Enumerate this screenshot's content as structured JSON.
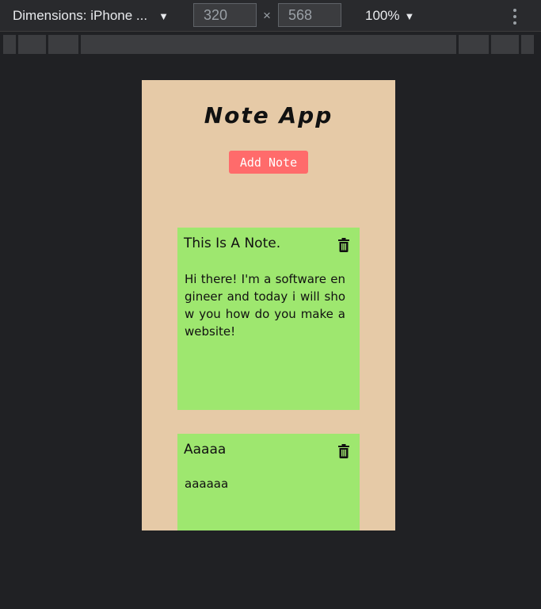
{
  "devtools": {
    "device_label": "Dimensions: iPhone ...",
    "width_value": "320",
    "height_value": "568",
    "times_symbol": "×",
    "zoom_label": "100%",
    "caret": "▼"
  },
  "app": {
    "title": "Note App",
    "add_button_label": "Add Note",
    "page_background": "#e6caa7",
    "note_color": "#9ee76f",
    "button_color": "#ff6b6b",
    "notes": [
      {
        "title": "This Is A Note.",
        "body": "Hi there! I'm a software engineer and today i will show you how do you make a website!",
        "delete_icon": "trash-icon"
      },
      {
        "title": "Aaaaa",
        "body": "aaaaaa",
        "delete_icon": "trash-icon"
      }
    ]
  }
}
